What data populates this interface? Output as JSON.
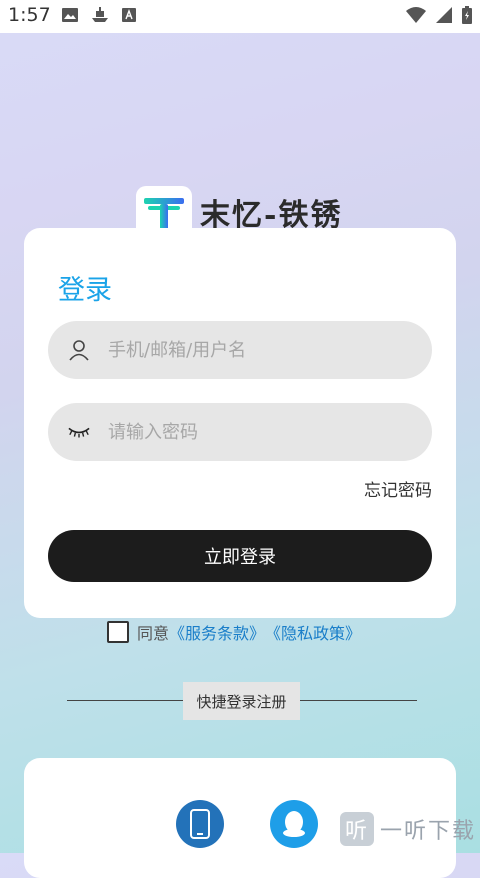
{
  "status_bar": {
    "time": "1:57",
    "left_icons": [
      "image-icon",
      "ship-icon",
      "font-icon"
    ],
    "right_icons": [
      "wifi-icon",
      "signal-icon",
      "battery-icon"
    ]
  },
  "brand": {
    "logo_letter": "T",
    "name": "末忆-铁锈"
  },
  "login_card": {
    "title": "登录",
    "username_placeholder": "手机/邮箱/用户名",
    "password_placeholder": "请输入密码",
    "forgot_label": "忘记密码",
    "login_button": "立即登录"
  },
  "agreement": {
    "prefix": "同意",
    "terms_link": "《服务条款》",
    "privacy_link": "《隐私政策》",
    "checked": false
  },
  "quick_login": {
    "label": "快捷登录注册",
    "options": [
      "phone-icon",
      "qq-icon"
    ]
  },
  "watermark": {
    "icon_text": "听",
    "text": "一听下载"
  },
  "colors": {
    "accent": "#1aa3e8",
    "button": "#1c1c1c",
    "link": "#1a7ec9",
    "phone_button": "#2372b9",
    "qq_button": "#1e9ee8"
  }
}
